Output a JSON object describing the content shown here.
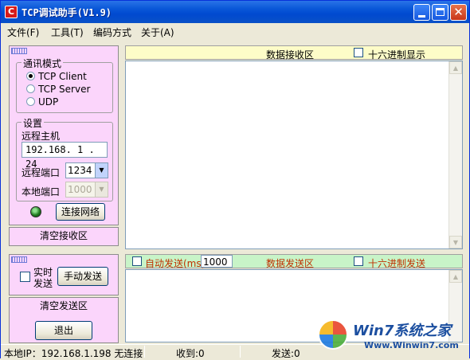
{
  "window": {
    "title": "TCP调试助手(V1.9)",
    "icon_letter": "C"
  },
  "menu": [
    {
      "label": "文件(F)"
    },
    {
      "label": "工具(T)"
    },
    {
      "label": "编码方式"
    },
    {
      "label": "关于(A)"
    }
  ],
  "comm_mode": {
    "title": "通讯模式",
    "options": [
      "TCP Client",
      "TCP Server",
      "UDP"
    ],
    "selected": "TCP Client"
  },
  "settings": {
    "title": "设置",
    "remote_host_label": "远程主机",
    "remote_host_value": "192.168. 1 . 24",
    "remote_port_label": "远程端口",
    "remote_port_value": "1234",
    "local_port_label": "本地端口",
    "local_port_value": "1000",
    "connect_button": "连接网络"
  },
  "clear_receive_button": "清空接收区",
  "send_panel": {
    "realtime_label_line1": "实时",
    "realtime_label_line2": "发送",
    "manual_send_button": "手动发送",
    "clear_send_button": "清空发送区",
    "exit_button": "退出"
  },
  "receive_area": {
    "title": "数据接收区",
    "hex_display_label": "十六进制显示"
  },
  "send_area": {
    "auto_send_label": "自动发送(ms)",
    "interval_value": "1000",
    "title": "数据发送区",
    "hex_send_label": "十六进制发送"
  },
  "status": {
    "local_ip": "本地IP：192.168.1.198 无连接",
    "received": "收到:0",
    "sent": "发送:0"
  },
  "watermark": {
    "title": "Win7系统之家",
    "url": "Www.Winwin7.com"
  },
  "colors": {
    "title_bar": "#0a58d8",
    "left_panel": "#fbd5fb",
    "receive_header": "#fdfcc8",
    "send_header": "#c8f4c8",
    "send_header_text": "#c03000"
  }
}
